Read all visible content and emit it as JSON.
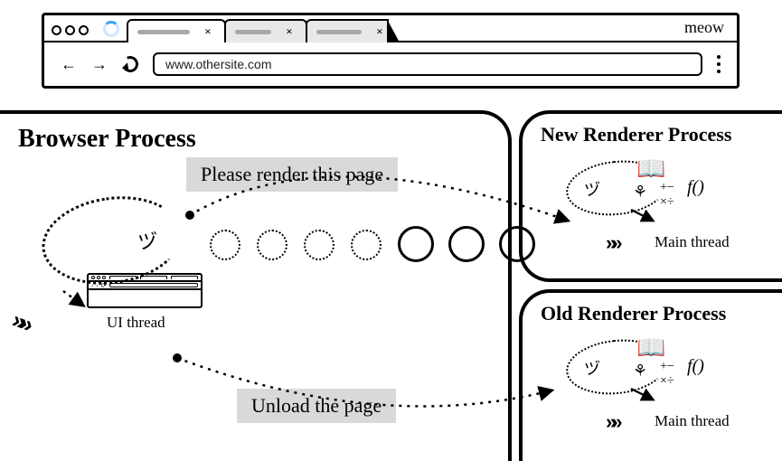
{
  "chrome": {
    "brand": "meow",
    "tabs": [
      {
        "close": "×"
      },
      {
        "close": "×"
      },
      {
        "close": "×"
      }
    ],
    "nav": {
      "back": "←",
      "forward": "→"
    },
    "url": "www.othersite.com"
  },
  "processes": {
    "browser": {
      "title": "Browser Process",
      "ui_thread_label": "UI thread",
      "message_render": "Please render this page",
      "message_unload": "Unload the page"
    },
    "new_renderer": {
      "title": "New Renderer Process",
      "main_thread_label": "Main thread",
      "fx_label": "f()"
    },
    "old_renderer": {
      "title": "Old Renderer Process",
      "main_thread_label": "Main thread",
      "fx_label": "f()"
    }
  },
  "chevron_glyph": "»»"
}
